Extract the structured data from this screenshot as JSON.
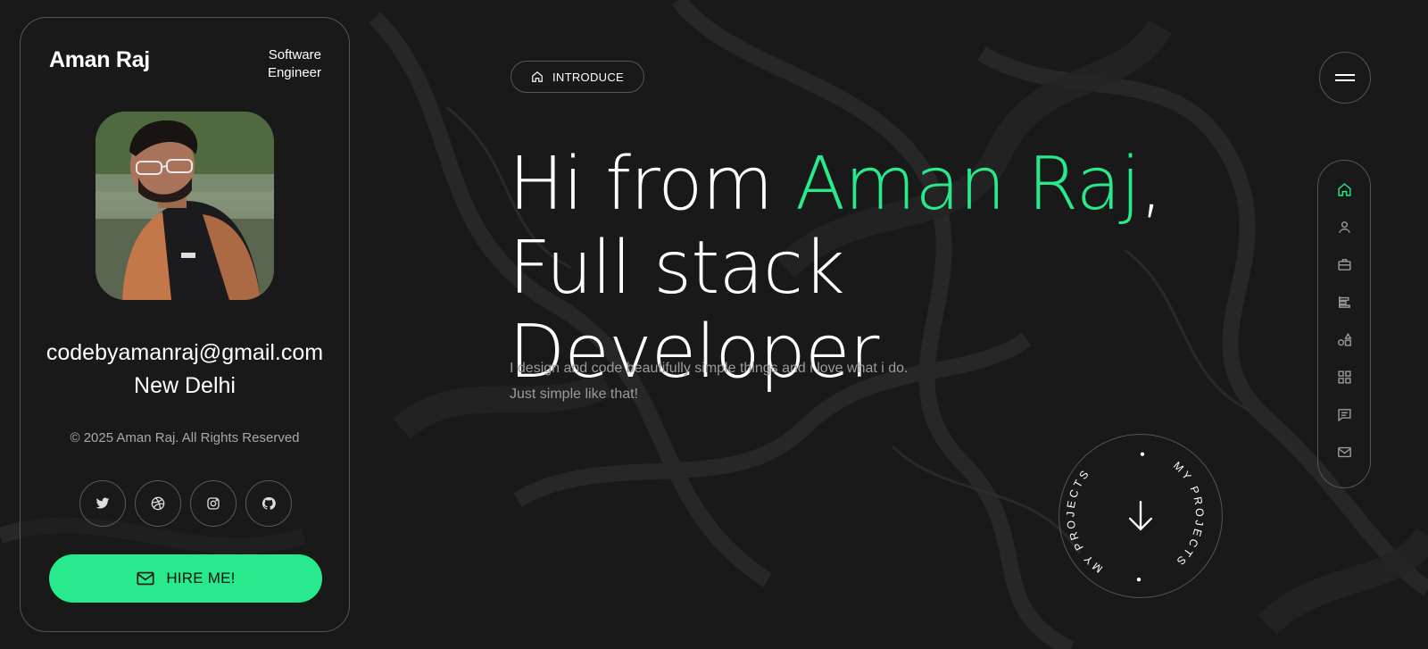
{
  "profile": {
    "name": "Aman Raj",
    "role": "Software Engineer",
    "email": "codebyamanraj@gmail.com",
    "city": "New Delhi",
    "copyright": "© 2025 Aman Raj. All Rights Reserved",
    "photo_icon": "profile-photo",
    "socials": [
      {
        "name": "twitter",
        "icon": "twitter-icon"
      },
      {
        "name": "dribbble",
        "icon": "dribbble-icon"
      },
      {
        "name": "instagram",
        "icon": "instagram-icon"
      },
      {
        "name": "github",
        "icon": "github-icon"
      }
    ],
    "hire_label": "HIRE ME!"
  },
  "hero": {
    "chip_label": "INTRODUCE",
    "greeting": "Hi from ",
    "name": "Aman Raj",
    "comma": ",",
    "title": "Full stack Developer",
    "lede_line1": "I design and code beautifully simple things and i love what i do.",
    "lede_line2": "Just simple like that!"
  },
  "projects_badge": {
    "text": "MY PROJECTS",
    "icon": "arrow-down-icon"
  },
  "nav": {
    "menu_icon": "hamburger-icon",
    "items": [
      {
        "icon": "home-icon",
        "active": true
      },
      {
        "icon": "user-icon",
        "active": false
      },
      {
        "icon": "briefcase-icon",
        "active": false
      },
      {
        "icon": "align-left-icon",
        "active": false
      },
      {
        "icon": "shapes-icon",
        "active": false
      },
      {
        "icon": "grid-icon",
        "active": false
      },
      {
        "icon": "message-icon",
        "active": false
      },
      {
        "icon": "mail-icon",
        "active": false
      }
    ]
  },
  "colors": {
    "accent": "#28e98c",
    "background": "#191919",
    "border": "#565656",
    "muted_text": "#9b9b9b"
  }
}
